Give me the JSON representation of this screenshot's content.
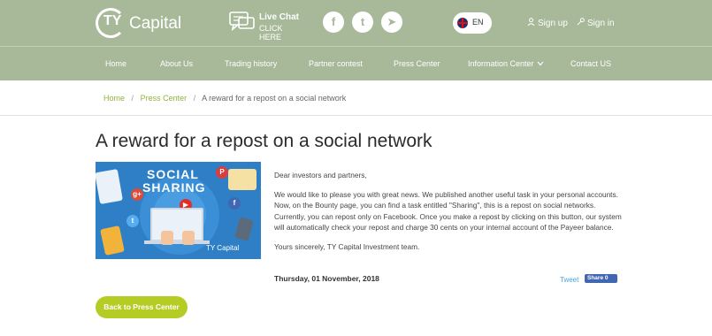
{
  "header": {
    "logo_text": "Capital",
    "logo_initials": "TY",
    "live_chat_title": "Live Chat",
    "live_chat_sub": "CLICK HERE",
    "social": [
      "f",
      "t",
      "➤"
    ],
    "lang_code": "EN",
    "sign_up": "Sign up",
    "sign_in": "Sign in"
  },
  "nav": {
    "items": [
      "Home",
      "About Us",
      "Trading history",
      "Partner contest",
      "Press Center",
      "Information Center",
      "Contact US"
    ]
  },
  "breadcrumb": {
    "home": "Home",
    "press": "Press Center",
    "current": "A reward for a repost on a social network",
    "sep": "/"
  },
  "article": {
    "title": "A reward for a repost on a social network",
    "hero_text1": "SOCIAL",
    "hero_text2": "SHARING",
    "hero_brand": "TY Capital",
    "greeting": "Dear investors and partners,",
    "paragraph": "We would like to please you with great news. We published another useful task in your personal accounts. Now, on the Bounty page, you can find a task entitled \"Sharing\", this is a repost on social networks. Currently, you can repost only on Facebook. Once you make a repost by clicking on this button, our system will automatically check your repost and charge 30 cents on your internal account of the Payeer balance.",
    "signoff": "Yours sincerely, TY Capital Investment team.",
    "date": "Thursday, 01 November, 2018",
    "tweet": "Tweet",
    "fb_share": "Share 0"
  },
  "back_button": "Back to Press Center",
  "colors": {
    "header_bg": "#a8b99a",
    "accent_green": "#b5cc24",
    "link_green": "#8fb33a"
  }
}
